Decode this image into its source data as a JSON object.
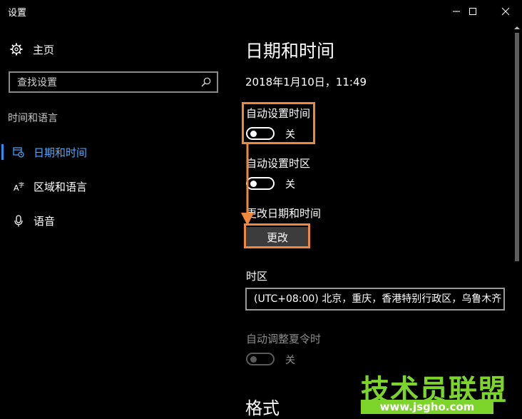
{
  "window": {
    "title": "设置",
    "minimize_icon": "minimize-icon",
    "maximize_icon": "maximize-icon",
    "close_icon": "close-icon"
  },
  "sidebar": {
    "home_label": "主页",
    "search_placeholder": "查找设置",
    "section_label": "时间和语言",
    "items": [
      {
        "label": "日期和时间",
        "icon": "calendar-clock-icon",
        "active": true
      },
      {
        "label": "区域和语言",
        "icon": "language-icon",
        "active": false
      },
      {
        "label": "语音",
        "icon": "microphone-icon",
        "active": false
      }
    ]
  },
  "main": {
    "title": "日期和时间",
    "current_datetime": "2018年1月10日，11:49",
    "auto_time": {
      "label": "自动设置时间",
      "state": "关"
    },
    "auto_timezone": {
      "label": "自动设置时区",
      "state": "关"
    },
    "change_datetime": {
      "label": "更改日期和时间",
      "button": "更改"
    },
    "timezone": {
      "label": "时区",
      "value": "(UTC+08:00) 北京，重庆，香港特别行政区，乌鲁木齐"
    },
    "dst": {
      "label": "自动调整夏令时",
      "state": "关"
    },
    "format_heading": "格式"
  },
  "watermark": {
    "text": "技术员联盟",
    "url": "www.jsgho.com"
  },
  "colors": {
    "accent": "#4ea7ff",
    "highlight": "#f0883c",
    "watermark": "#7dd42a"
  }
}
